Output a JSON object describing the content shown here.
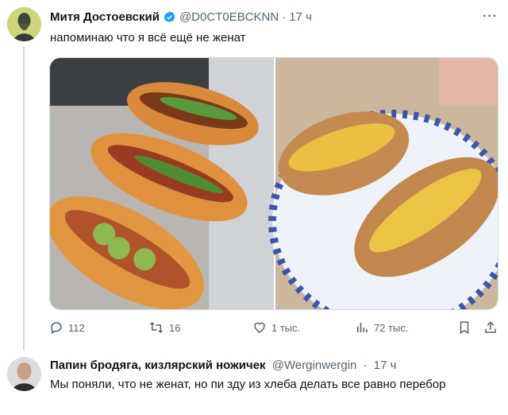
{
  "tweet": {
    "author_name": "Митя Достоевский",
    "author_handle": "@D0CT0EBCKNN",
    "separator": "·",
    "time": "17 ч",
    "text": "напоминаю что я всё ещё не женат",
    "more_icon": "more-horizontal-icon",
    "verified_color": "#1d9bf0"
  },
  "media": {
    "left_image": "hot-dog-buns-with-salmon-cucumber-photo",
    "right_image": "cheese-baked-buns-on-plate-photo"
  },
  "actions": {
    "reply_count": "112",
    "retweet_count": "16",
    "like_count": "1 тыс.",
    "views_count": "72 тыс."
  },
  "reply": {
    "author_name": "Папин бродяга, кизлярский ножичек",
    "author_handle": "@Werginwergin",
    "separator": "·",
    "time": "17 ч",
    "text": "Мы поняли, что не женат, но пи    зду из хлеба делать все равно перебор"
  }
}
